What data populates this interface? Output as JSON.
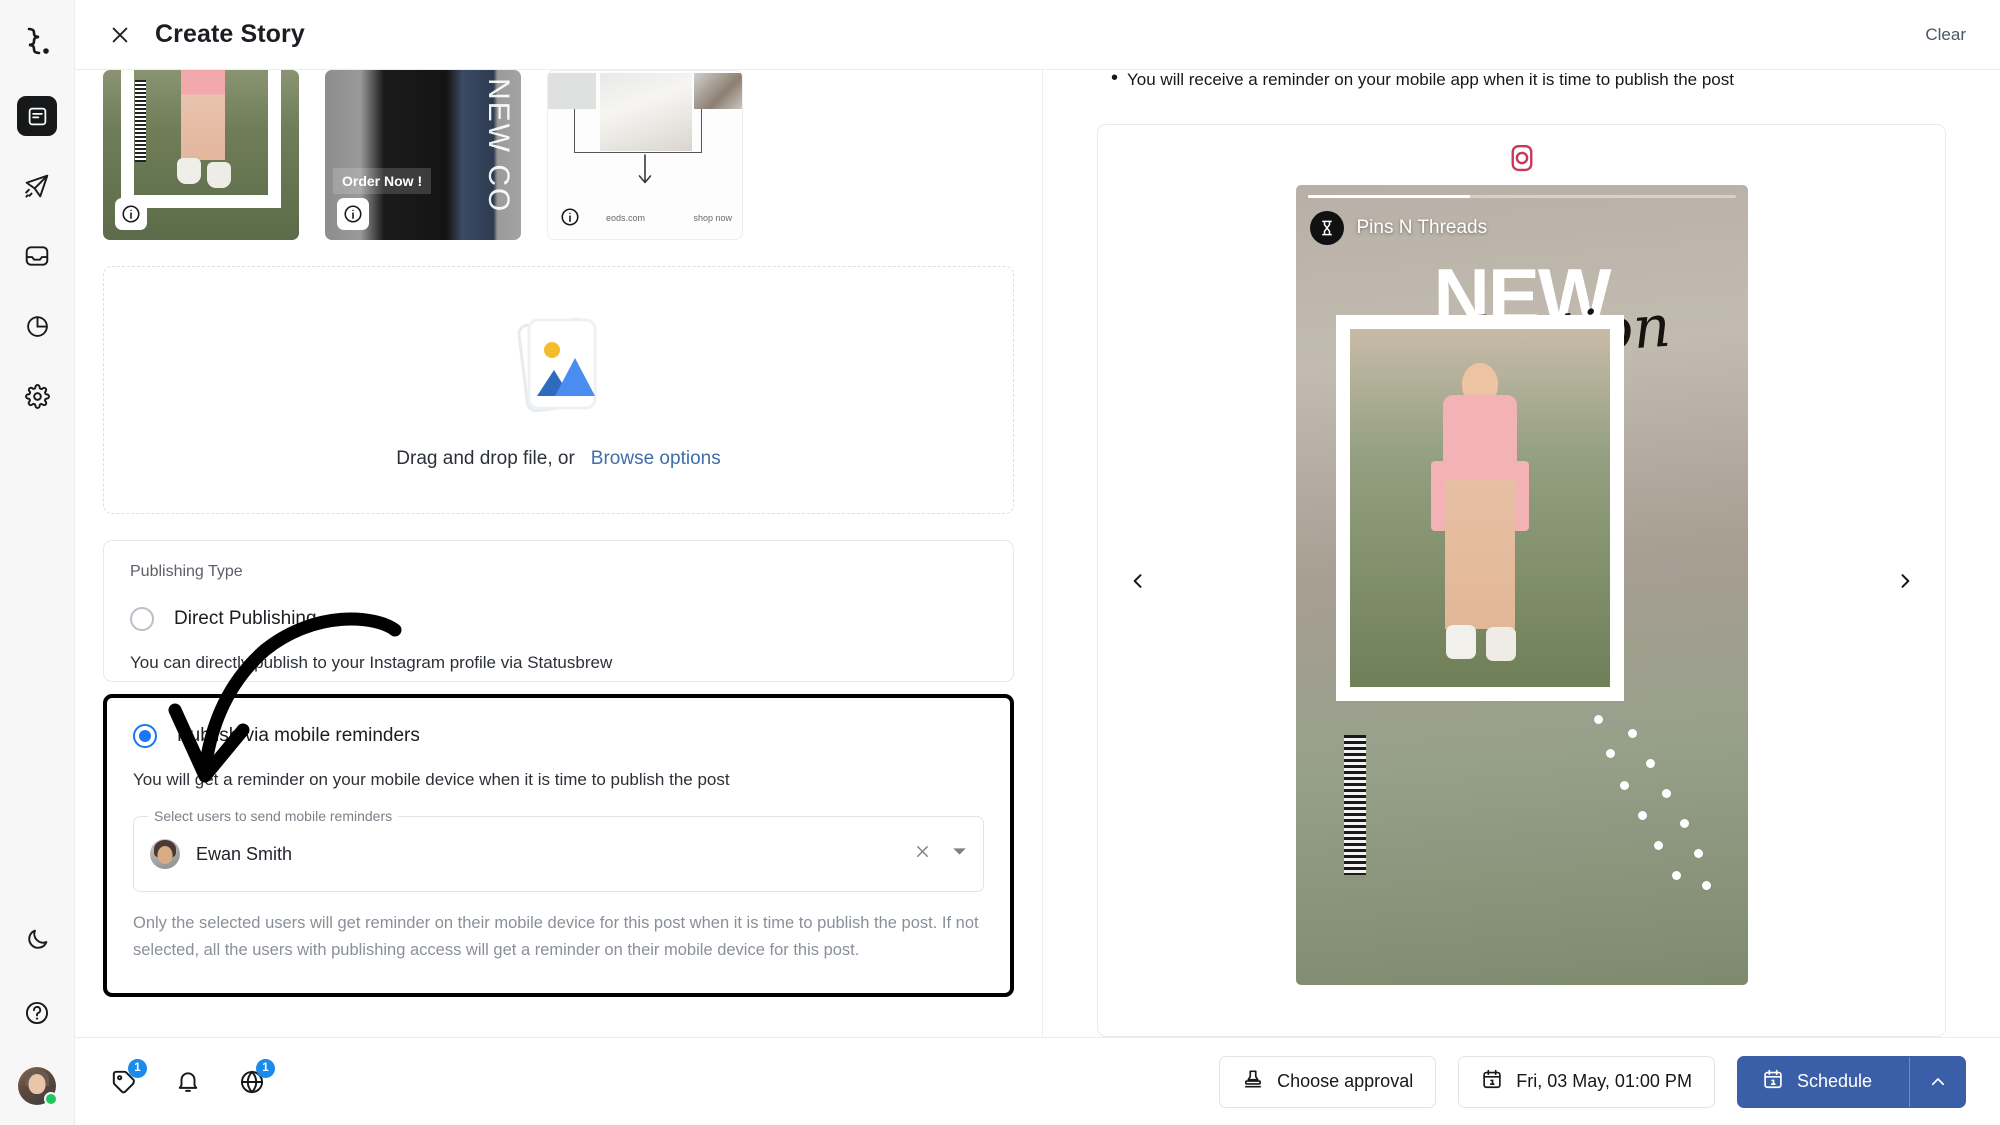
{
  "app": {
    "brand_icon": "statusbrew-logo-icon",
    "accent_blue": "#1877f2",
    "primary_button": "#3a5fa8",
    "badge_blue": "#1b8ae8"
  },
  "sidebar": {
    "items": [
      {
        "name": "compose-icon",
        "label": "Compose",
        "active": true
      },
      {
        "name": "publish-icon",
        "label": "Publish",
        "active": false
      },
      {
        "name": "inbox-icon",
        "label": "Inbox",
        "active": false
      },
      {
        "name": "reports-icon",
        "label": "Reports",
        "active": false
      },
      {
        "name": "settings-icon",
        "label": "Settings",
        "active": false
      }
    ],
    "bottom": [
      {
        "name": "dark-mode-icon",
        "label": "Dark mode"
      },
      {
        "name": "help-icon",
        "label": "Help"
      }
    ],
    "avatar_status": "online"
  },
  "header": {
    "close_label": "Close",
    "title": "Create Story",
    "clear_label": "Clear"
  },
  "composer": {
    "thumbnails": [
      {
        "id": "thumb-1",
        "alt": "Model in pink shorts outdoors",
        "info_label": "i"
      },
      {
        "id": "thumb-2",
        "alt": "New Collection black jacket",
        "overlay_text": "Order Now !",
        "vertical_text": "NEW CO",
        "info_label": "i"
      },
      {
        "id": "thumb-3",
        "alt": "Product card",
        "footer_left": "eods.com",
        "footer_right": "shop now",
        "info_label": "i"
      }
    ],
    "dropzone": {
      "text": "Drag and drop file, or",
      "browse_label": "Browse options",
      "art": "image-placeholder-icon"
    },
    "publishing_type": {
      "section_label": "Publishing Type",
      "options": [
        {
          "id": "direct-publishing",
          "label": "Direct Publishing",
          "description": "You can directly publish to your Instagram profile via Statusbrew",
          "selected": false
        },
        {
          "id": "mobile-reminders",
          "label": "Publish via mobile reminders",
          "description": "You will get a reminder on your mobile device when it is time to publish the post",
          "selected": true
        }
      ],
      "user_select": {
        "legend": "Select users to send mobile reminders",
        "selected_user": "Ewan Smith",
        "clear_icon": "close-icon",
        "dropdown_icon": "chevron-down-icon"
      },
      "hint": "Only the selected users will get reminder on their mobile device for this post when it is time to publish the post. If not selected, all the users with publishing access will get a reminder on their mobile device for this post."
    }
  },
  "preview": {
    "note": "You will receive a reminder on your mobile app when it is time to publish the post",
    "network_icon": "instagram-icon",
    "prev_icon": "chevron-left-icon",
    "next_icon": "chevron-right-icon",
    "story": {
      "account_name": "Pins N Threads",
      "headline": "NEW",
      "subhead": "Collection"
    }
  },
  "footer": {
    "icons": [
      {
        "name": "tag-icon",
        "label": "Tags",
        "badge": "1"
      },
      {
        "name": "bell-icon",
        "label": "Notifications",
        "badge": ""
      },
      {
        "name": "globe-icon",
        "label": "Networks",
        "badge": "1"
      }
    ],
    "approval_button": "Choose approval",
    "approval_icon": "stamp-icon",
    "schedule_datetime": "Fri, 03 May, 01:00 PM",
    "schedule_date_icon": "calendar-icon",
    "schedule_button": "Schedule",
    "schedule_button_icon": "calendar-icon",
    "schedule_caret_icon": "chevron-up-icon"
  }
}
